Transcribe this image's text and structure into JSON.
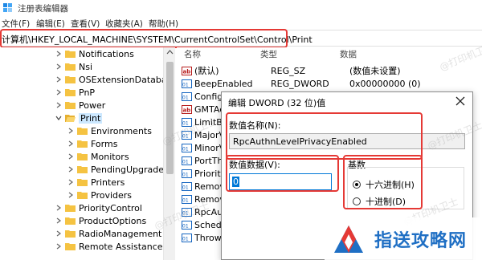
{
  "window": {
    "title": "注册表编辑器",
    "icon": "regedit-icon"
  },
  "menu": [
    "文件(F)",
    "编辑(E)",
    "查看(V)",
    "收藏夹(A)",
    "帮助(H)"
  ],
  "address": "计算机\\HKEY_LOCAL_MACHINE\\SYSTEM\\CurrentControlSet\\Control\\Print",
  "tree": {
    "items": [
      {
        "label": "Notifications",
        "expanded": false,
        "selected": false
      },
      {
        "label": "Nsi",
        "expanded": false,
        "selected": false
      },
      {
        "label": "OSExtensionDatabase",
        "expanded": false,
        "selected": false
      },
      {
        "label": "PnP",
        "expanded": false,
        "selected": false
      },
      {
        "label": "Power",
        "expanded": false,
        "selected": false
      },
      {
        "label": "Print",
        "expanded": true,
        "selected": true
      },
      {
        "label": "Environments",
        "expanded": false,
        "selected": false
      },
      {
        "label": "Forms",
        "expanded": false,
        "selected": false
      },
      {
        "label": "Monitors",
        "expanded": false,
        "selected": false
      },
      {
        "label": "PendingUpgrades",
        "expanded": false,
        "selected": false
      },
      {
        "label": "Printers",
        "expanded": false,
        "selected": false
      },
      {
        "label": "Providers",
        "expanded": false,
        "selected": false
      },
      {
        "label": "PriorityControl",
        "expanded": false,
        "selected": false
      },
      {
        "label": "ProductOptions",
        "expanded": false,
        "selected": false
      },
      {
        "label": "RadioManagement",
        "expanded": false,
        "selected": false
      },
      {
        "label": "Remote Assistance",
        "expanded": false,
        "selected": false
      }
    ]
  },
  "values_pane": {
    "columns": {
      "name": "名称",
      "type": "类型",
      "data": "数据"
    },
    "rows": [
      {
        "name": "(默认)",
        "type": "REG_SZ",
        "data": "(数值未设置)",
        "icon": "string-value-icon"
      },
      {
        "name": "BeepEnabled",
        "type": "REG_DWORD",
        "data": "0x00000000 (0)",
        "icon": "binary-value-icon"
      },
      {
        "name": "Configur",
        "type": "",
        "data": "",
        "icon": "binary-value-icon"
      },
      {
        "name": "GMTAc",
        "type": "",
        "data": "",
        "icon": "string-value-icon"
      },
      {
        "name": "LimitBla",
        "type": "",
        "data": "",
        "icon": "binary-value-icon"
      },
      {
        "name": "MajorVe",
        "type": "",
        "data": "",
        "icon": "binary-value-icon"
      },
      {
        "name": "MinorVe",
        "type": "",
        "data": "",
        "icon": "binary-value-icon"
      },
      {
        "name": "PortThr",
        "type": "",
        "data": "",
        "icon": "binary-value-icon"
      },
      {
        "name": "Priority",
        "type": "",
        "data": "",
        "icon": "binary-value-icon"
      },
      {
        "name": "Remov",
        "type": "",
        "data": "",
        "icon": "binary-value-icon"
      },
      {
        "name": "Remov",
        "type": "",
        "data": "",
        "icon": "binary-value-icon"
      },
      {
        "name": "RpcAut",
        "type": "",
        "data": "",
        "icon": "binary-value-icon"
      },
      {
        "name": "Schedu",
        "type": "",
        "data": "",
        "icon": "binary-value-icon"
      },
      {
        "name": "ThrowD",
        "type": "",
        "data": "",
        "icon": "binary-value-icon"
      }
    ]
  },
  "dialog": {
    "title": "编辑 DWORD (32 位)值",
    "name_label": "数值名称(N):",
    "name_value": "RpcAuthnLevelPrivacyEnabled",
    "data_label": "数值数据(V):",
    "data_value": "0",
    "base_label": "基数",
    "base_options": [
      {
        "label": "十六进制(H)",
        "selected": true
      },
      {
        "label": "十进制(D)",
        "selected": false
      }
    ]
  },
  "watermark": "@打印机卫士",
  "brand": {
    "name": "指送攻略网",
    "logo": "brand-logo-icon"
  },
  "colors": {
    "highlight": "#e53935",
    "selection": "#cce8ff",
    "accent": "#0078d7",
    "folder": "#f5c342",
    "brand": "#1f6fc4"
  }
}
